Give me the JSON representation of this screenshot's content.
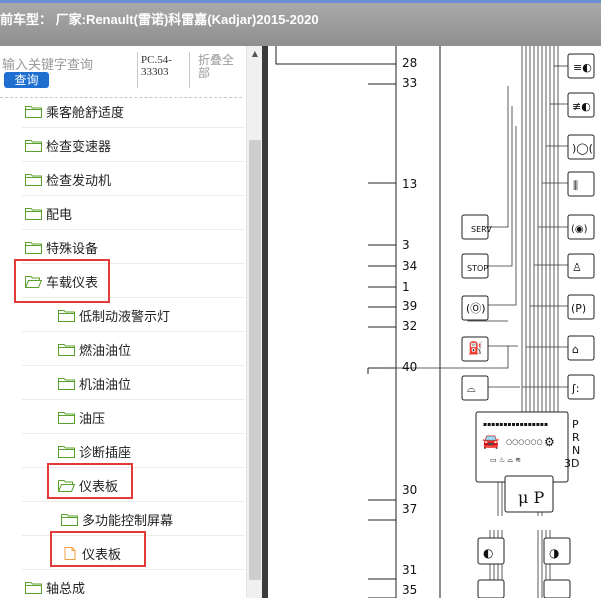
{
  "header": {
    "title": "前车型： 厂家:Renault(雷诺)科雷嘉(Kadjar)2015-2020"
  },
  "search": {
    "placeholder": "输入关键字查询",
    "button": "查询",
    "doc_id": "PC.54-33303",
    "collapse_all": "折叠全部"
  },
  "tree": [
    {
      "label": "乘客舱舒适度",
      "level": 1,
      "open": false
    },
    {
      "label": "检查变速器",
      "level": 1,
      "open": false
    },
    {
      "label": "检查发动机",
      "level": 1,
      "open": false
    },
    {
      "label": "配电",
      "level": 1,
      "open": false
    },
    {
      "label": "特殊设备",
      "level": 1,
      "open": false
    },
    {
      "label": "车载仪表",
      "level": 1,
      "open": true,
      "highlighted": true
    },
    {
      "label": "低制动液警示灯",
      "level": 2,
      "open": false
    },
    {
      "label": "燃油油位",
      "level": 2,
      "open": false
    },
    {
      "label": "机油油位",
      "level": 2,
      "open": false
    },
    {
      "label": "油压",
      "level": 2,
      "open": false
    },
    {
      "label": "诊断插座",
      "level": 2,
      "open": false
    },
    {
      "label": "仪表板",
      "level": 2,
      "open": true,
      "highlighted": true
    },
    {
      "label": "多功能控制屏幕",
      "level": 3,
      "open": false
    },
    {
      "label": "仪表板",
      "level": 3,
      "open": false,
      "file": true,
      "highlighted": true
    },
    {
      "label": "轴总成",
      "level": 1,
      "open": false
    }
  ],
  "diagram": {
    "pins": [
      "28",
      "33",
      "13",
      "3",
      "34",
      "1",
      "39",
      "32",
      "40",
      "30",
      "37",
      "31",
      "35"
    ],
    "labels": {
      "serv": "SERV",
      "stop": "STOP",
      "mu_p": "μ P",
      "gear_p": "P",
      "gear_r": "R",
      "gear_n": "N",
      "gear_3d": "3D"
    }
  },
  "colors": {
    "highlight": "#e03a3a",
    "folder": "#5aa02c",
    "file": "#f0a040",
    "button": "#1e6fd0"
  }
}
